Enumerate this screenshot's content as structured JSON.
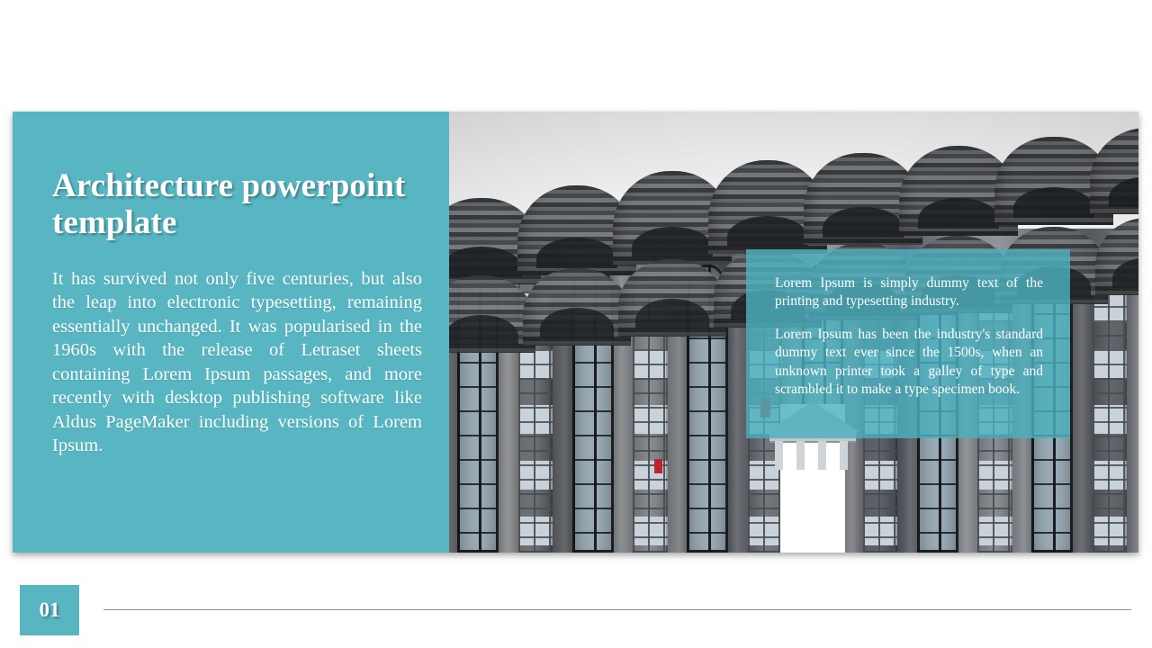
{
  "slide": {
    "title": "Architecture powerpoint template",
    "body": "It has survived not only five centuries, but also the leap into electronic typesetting, remaining essentially unchanged. It was popularised in the 1960s with the release of Letraset sheets containing Lorem Ipsum passages, and more recently with desktop publishing software like Aldus PageMaker including versions of Lorem Ipsum."
  },
  "overlay": {
    "paragraph_1": "Lorem Ipsum is simply dummy text of the printing and typesetting industry.",
    "paragraph_2": "Lorem Ipsum has been the industry's standard dummy text ever since the 1500s, when an unknown printer took a galley of type and scrambled it to make a type specimen book."
  },
  "footer": {
    "page_number": "01"
  },
  "photo": {
    "subject": "concrete-apartment-building-facade"
  },
  "colors": {
    "teal_panel": "#57b6c2",
    "teal_overlay": "#4cb0be",
    "text_on_teal": "#ffffff",
    "footer_rule": "#8d9095",
    "slide_background": "#ffffff"
  }
}
